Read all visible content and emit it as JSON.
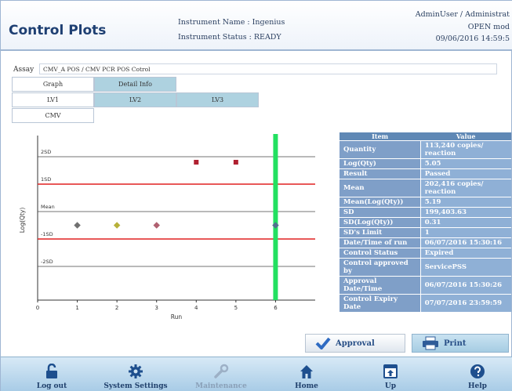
{
  "header": {
    "title": "Control Plots",
    "instrument_name": "Instrument Name : Ingenius",
    "instrument_status": "Instrument Status : READY",
    "user": "AdminUser / Administrat",
    "mode": "OPEN mod",
    "datetime": "09/06/2016 14:59:5"
  },
  "assay": {
    "label": "Assay",
    "value": "CMV_A POS / CMV PCR POS Cotrol"
  },
  "tabs": {
    "graph": "Graph",
    "detail_info": "Detail Info",
    "lv1": "LV1",
    "lv2": "LV2",
    "lv3": "LV3",
    "cmv": "CMV"
  },
  "chart_data": {
    "type": "scatter",
    "ylabel": "Log(Qty)",
    "xlabel": "Run",
    "x_ticks": [
      "0",
      "1",
      "2",
      "3",
      "4",
      "5",
      "6"
    ],
    "y_levels": [
      "2SD",
      "1SD",
      "Mean",
      "-1SD",
      "-2SD"
    ],
    "points": [
      {
        "x": 1,
        "level": -0.5,
        "color": "#707070"
      },
      {
        "x": 2,
        "level": -0.5,
        "color": "#b7b13a"
      },
      {
        "x": 3,
        "level": -0.5,
        "color": "#b06070"
      },
      {
        "x": 4,
        "level": 1.8,
        "color": "#b02030"
      },
      {
        "x": 5,
        "level": 1.8,
        "color": "#b02030"
      },
      {
        "x": 6,
        "level": -0.5,
        "color": "#507090"
      }
    ],
    "highlight_run": 6,
    "control_limits": [
      "1SD",
      "-1SD"
    ],
    "limit_color": "#e02020",
    "highlight_color": "#22e060"
  },
  "table": {
    "headers": [
      "Item",
      "Value"
    ],
    "rows": [
      {
        "item": "Quantity",
        "value": "113,240 copies/ reaction"
      },
      {
        "item": "Log(Qty)",
        "value": "5.05"
      },
      {
        "item": "Result",
        "value": "Passed"
      },
      {
        "item": "Mean",
        "value": "202,416 copies/ reaction"
      },
      {
        "item": "Mean(Log(Qty))",
        "value": "5.19"
      },
      {
        "item": "SD",
        "value": "199,403.63"
      },
      {
        "item": "SD(Log(Qty))",
        "value": "0.31"
      },
      {
        "item": "SD's Limit",
        "value": "1"
      },
      {
        "item": "Date/Time of run",
        "value": "06/07/2016 15:30:16"
      },
      {
        "item": "Control Status",
        "value": "Expired"
      },
      {
        "item": "Control approved by",
        "value": "ServicePSS"
      },
      {
        "item": "Approval Date/Time",
        "value": "06/07/2016 15:30:26"
      },
      {
        "item": "Control Expiry Date",
        "value": "07/07/2016 23:59:59"
      }
    ]
  },
  "actions": {
    "approval": "Approval",
    "print": "Print"
  },
  "footer": {
    "logout": "Log out",
    "system_settings": "System Settings",
    "maintenance": "Maintenance",
    "home": "Home",
    "up": "Up",
    "help": "Help"
  }
}
